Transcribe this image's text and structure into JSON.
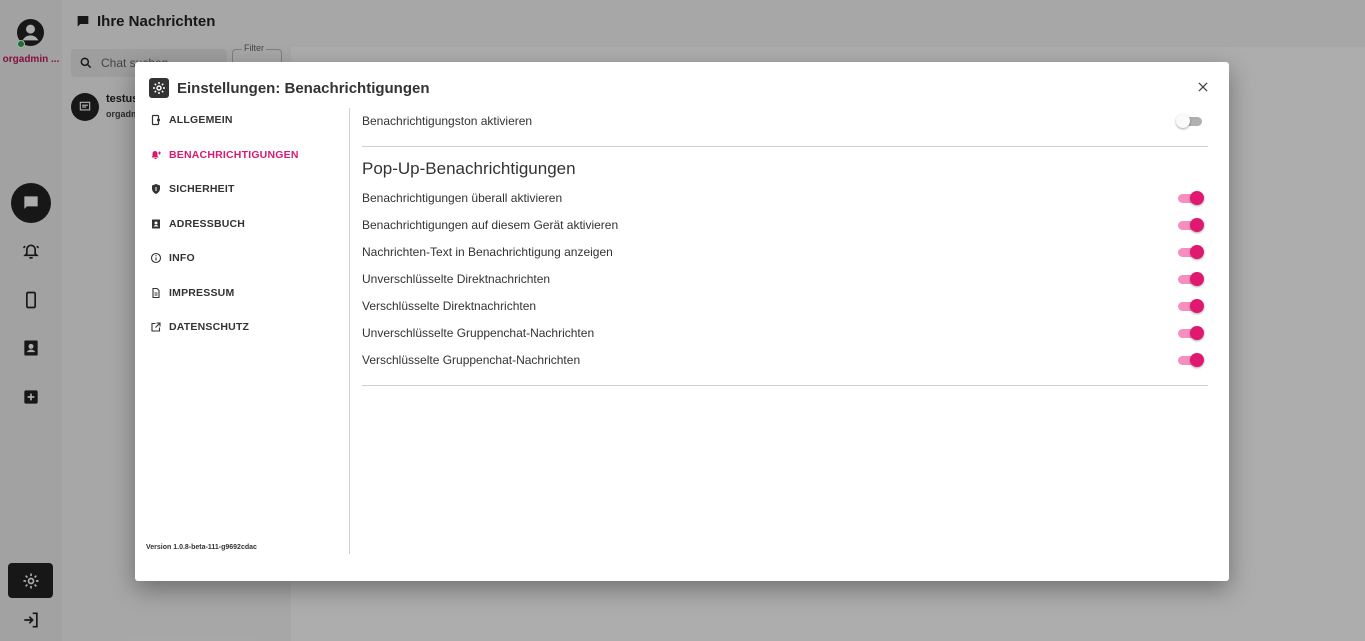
{
  "app": {
    "page_title": "Ihre Nachrichten",
    "rail_username": "orgadmin ...",
    "search_placeholder": "Chat suchen",
    "filter_label": "Filter",
    "chat_item": {
      "name": "testus",
      "sub": "orgadm"
    }
  },
  "dialog": {
    "title": "Einstellungen: Benachrichtigungen",
    "version": "Version 1.0.8-beta-111-g9692cdac",
    "nav": [
      {
        "label": "ALLGEMEIN",
        "icon": "device-settings-icon",
        "active": false
      },
      {
        "label": "BENACHRICHTIGUNGEN",
        "icon": "bell-plus-icon",
        "active": true
      },
      {
        "label": "SICHERHEIT",
        "icon": "shield-icon",
        "active": false
      },
      {
        "label": "ADRESSBUCH",
        "icon": "contacts-icon",
        "active": false
      },
      {
        "label": "INFO",
        "icon": "info-icon",
        "active": false
      },
      {
        "label": "IMPRESSUM",
        "icon": "document-icon",
        "active": false
      },
      {
        "label": "DATENSCHUTZ",
        "icon": "external-link-icon",
        "active": false
      }
    ],
    "sound_label": "Benachrichtigungston aktivieren",
    "sound_on": false,
    "popup_section_title": "Pop-Up-Benachrichtigungen",
    "popup_settings": [
      {
        "label": "Benachrichtigungen überall aktivieren",
        "on": true
      },
      {
        "label": "Benachrichtigungen auf diesem Gerät aktivieren",
        "on": true
      },
      {
        "label": "Nachrichten-Text in Benachrichtigung anzeigen",
        "on": true
      },
      {
        "label": "Unverschlüsselte Direktnachrichten",
        "on": true
      },
      {
        "label": "Verschlüsselte Direktnachrichten",
        "on": true
      },
      {
        "label": "Unverschlüsselte Gruppenchat-Nachrichten",
        "on": true
      },
      {
        "label": "Verschlüsselte Gruppenchat-Nachrichten",
        "on": true
      }
    ]
  },
  "colors": {
    "accent": "#e0186f",
    "accent_light": "#f48fbf",
    "dark": "#222222"
  }
}
